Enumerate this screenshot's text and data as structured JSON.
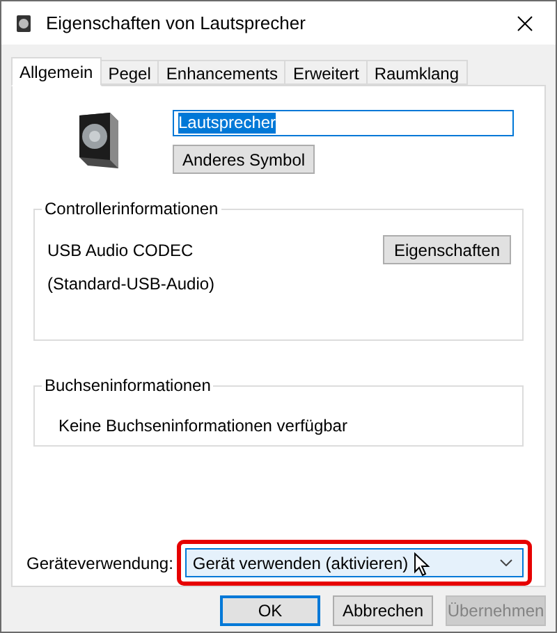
{
  "window": {
    "title": "Eigenschaften von Lautsprecher"
  },
  "tabs": [
    {
      "label": "Allgemein",
      "selected": true
    },
    {
      "label": "Pegel",
      "selected": false
    },
    {
      "label": "Enhancements",
      "selected": false
    },
    {
      "label": "Erweitert",
      "selected": false
    },
    {
      "label": "Raumklang",
      "selected": false
    }
  ],
  "device_name": {
    "value": "Lautsprecher",
    "selected": true
  },
  "change_icon_button": "Anderes Symbol",
  "controller_info": {
    "title": "Controllerinformationen",
    "name": "USB Audio CODEC",
    "driver": "(Standard-USB-Audio)",
    "button": "Eigenschaften"
  },
  "jack_info": {
    "title": "Buchseninformationen",
    "text": "Keine Buchseninformationen verfügbar"
  },
  "device_usage": {
    "label": "Geräteverwendung:",
    "value": "Gerät verwenden (aktivieren)",
    "highlighted": true
  },
  "buttons": [
    {
      "label": "OK",
      "default": true,
      "disabled": false
    },
    {
      "label": "Abbrechen",
      "default": false,
      "disabled": false
    },
    {
      "label": "Übernehmen",
      "default": false,
      "disabled": true
    }
  ]
}
